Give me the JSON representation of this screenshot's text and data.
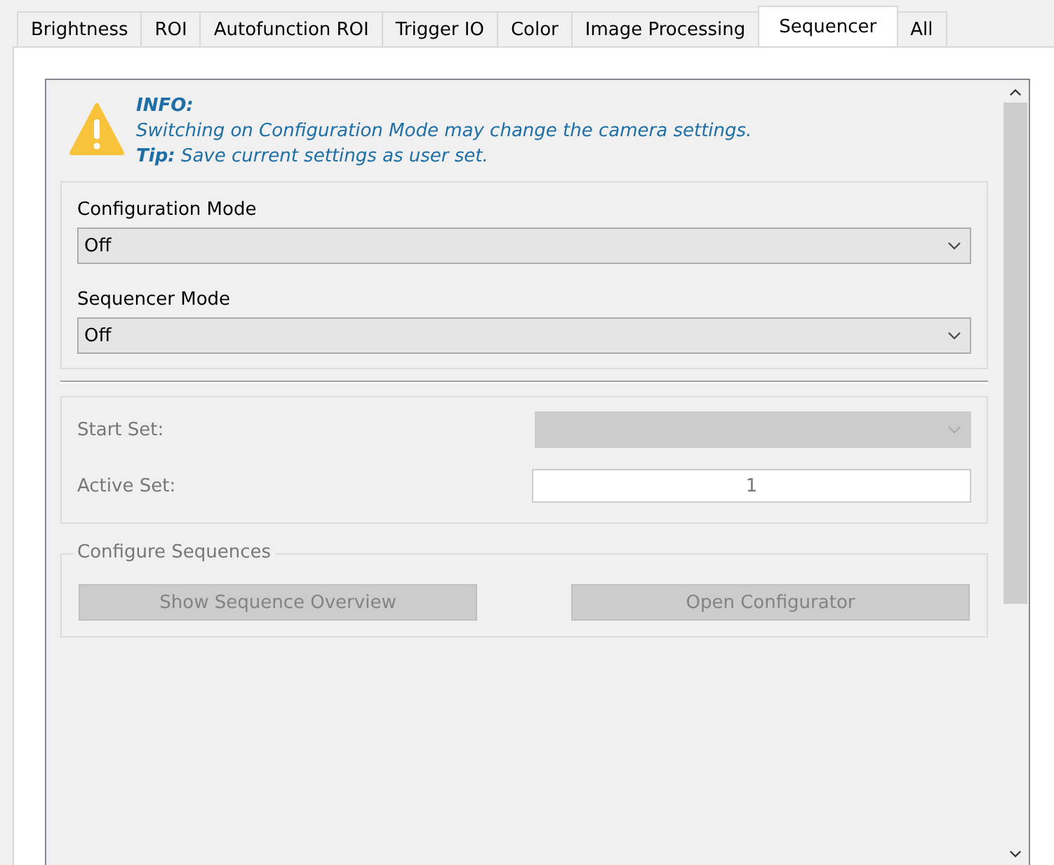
{
  "tabs": [
    {
      "label": "Brightness",
      "selected": false
    },
    {
      "label": "ROI",
      "selected": false
    },
    {
      "label": "Autofunction ROI",
      "selected": false
    },
    {
      "label": "Trigger IO",
      "selected": false
    },
    {
      "label": "Color",
      "selected": false
    },
    {
      "label": "Image Processing",
      "selected": false
    },
    {
      "label": "Sequencer",
      "selected": true
    },
    {
      "label": "All",
      "selected": false
    }
  ],
  "info": {
    "title": "INFO:",
    "message": "Switching on Configuration Mode may change the camera settings.",
    "tip": "**Tip:** Save current settings as user set."
  },
  "modes": [
    {
      "label": "Configuration Mode",
      "value": "Off",
      "disabled": false
    },
    {
      "label": "Sequencer Mode",
      "value": "Off",
      "disabled": false
    }
  ],
  "sets": [
    {
      "kind": "dropdown",
      "label": "Start Set:",
      "disabled": true
    },
    {
      "kind": "number",
      "label": "Active Set:",
      "value": "1",
      "disabled": true
    }
  ],
  "configure_sequences": {
    "title": "Configure Sequences",
    "buttons": [
      {
        "label": "Show Sequence Overview",
        "disabled": true
      },
      {
        "label": "Open Configurator",
        "disabled": true
      }
    ]
  }
}
